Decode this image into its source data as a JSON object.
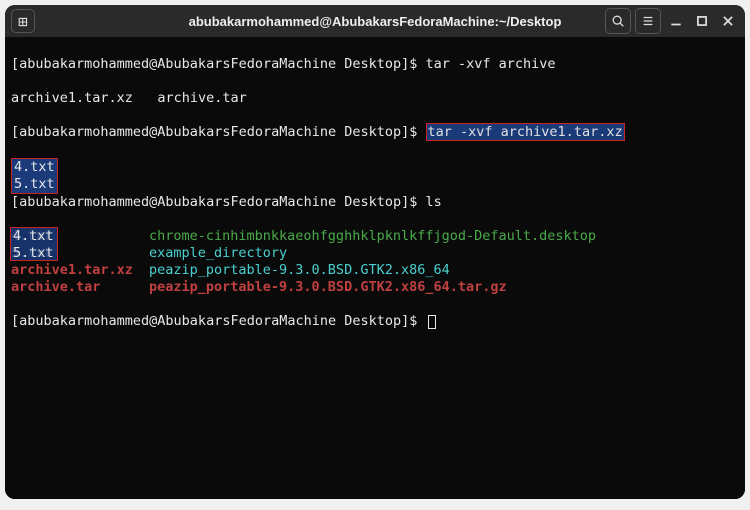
{
  "titlebar": {
    "new_tab_glyph": "⊞",
    "title": "abubakarmohammed@AbubakarsFedoraMachine:~/Desktop",
    "search_label": "Search",
    "menu_label": "Menu",
    "minimize_label": "Minimize",
    "maximize_label": "Maximize",
    "close_label": "Close"
  },
  "prompt_text": "[abubakarmohammed@AbubakarsFedoraMachine Desktop]$ ",
  "lines": {
    "cmd1": "tar -xvf archive",
    "out1a": "archive1.tar.xz",
    "out1b": "archive.tar",
    "cmd2": "tar -xvf archive1.tar.xz",
    "out2a": "4.txt",
    "out2b": "5.txt",
    "cmd3": "ls"
  },
  "ls": [
    {
      "c1": "4.txt",
      "c1_class": "file",
      "c2": "chrome-cinhimbnkkaeohfgghhklpknlkffjgod-Default.desktop",
      "c2_class": "file green",
      "c1_hl": true
    },
    {
      "c1": "5.txt",
      "c1_class": "file",
      "c2": "example_directory",
      "c2_class": "file cyan",
      "c1_hl": true
    },
    {
      "c1": "archive1.tar.xz",
      "c1_class": "file redb",
      "c2": "peazip_portable-9.3.0.BSD.GTK2.x86_64",
      "c2_class": "file cyan",
      "c1_hl": false
    },
    {
      "c1": "archive.tar",
      "c1_class": "file redb",
      "c2": "peazip_portable-9.3.0.BSD.GTK2.x86_64.tar.gz",
      "c2_class": "file redb",
      "c1_hl": false
    }
  ]
}
